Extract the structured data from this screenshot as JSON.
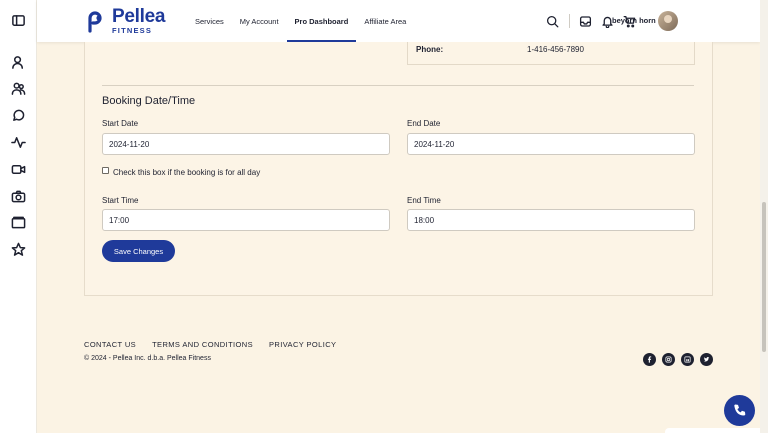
{
  "brand": {
    "name": "Pellea",
    "sub": "FITNESS",
    "color": "#1f3a9a"
  },
  "nav": {
    "items": [
      {
        "label": "Services"
      },
      {
        "label": "My Account"
      },
      {
        "label": "Pro Dashboard",
        "active": true
      },
      {
        "label": "Affiliate Area"
      }
    ]
  },
  "topbar": {
    "icons": [
      "search-icon",
      "inbox-icon",
      "bell-icon",
      "cart-icon"
    ],
    "user_name": "beyorn horn"
  },
  "sidebar": {
    "icons": [
      "sidebar-toggle-icon",
      "user-icon",
      "users-icon",
      "chat-icon",
      "activity-icon",
      "video-icon",
      "camera-icon",
      "folder-icon",
      "star-icon"
    ]
  },
  "contact": {
    "phone_label": "Phone:",
    "phone_value": "1-416-456-7890"
  },
  "booking": {
    "title": "Booking Date/Time",
    "start_date_label": "Start Date",
    "start_date_value": "2024-11-20",
    "end_date_label": "End Date",
    "end_date_value": "2024-11-20",
    "all_day_label": "Check this box if the booking is for all day",
    "all_day_checked": false,
    "start_time_label": "Start Time",
    "start_time_value": "17:00",
    "end_time_label": "End Time",
    "end_time_value": "18:00",
    "save_label": "Save Changes"
  },
  "footer": {
    "links": [
      "CONTACT US",
      "TERMS AND CONDITIONS",
      "PRIVACY POLICY"
    ],
    "copyright": "© 2024 - Pellea Inc. d.b.a. Pellea Fitness",
    "socials": [
      "facebook-icon",
      "instagram-icon",
      "linkedin-icon",
      "twitter-icon"
    ]
  },
  "colors": {
    "background": "#fbf3e4",
    "accent": "#1f3a9a"
  }
}
